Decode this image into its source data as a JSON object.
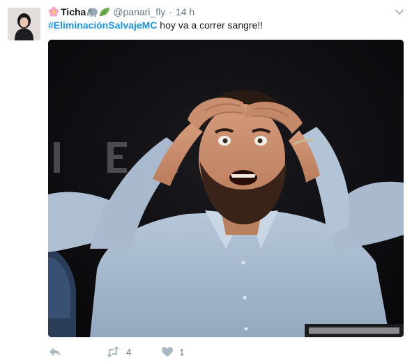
{
  "tweet": {
    "author_name": "Ticha",
    "author_emojis": [
      "cherry-blossom-icon",
      "elephant-icon",
      "leaf-icon"
    ],
    "handle": "@panari_fly",
    "separator": "·",
    "time": "14 h",
    "hashtag": "#EliminaciónSalvajeMC",
    "text": " hoy va a correr sangre!!",
    "media_sign_letters": "I E L"
  },
  "actions": {
    "reply_icon": "reply-icon",
    "retweet_icon": "retweet-icon",
    "retweet_count": "4",
    "like_icon": "heart-icon",
    "like_count": "1"
  },
  "colors": {
    "link": "#1b95e0",
    "text": "#14171a",
    "muted": "#657786",
    "icon": "#aab8c2"
  }
}
